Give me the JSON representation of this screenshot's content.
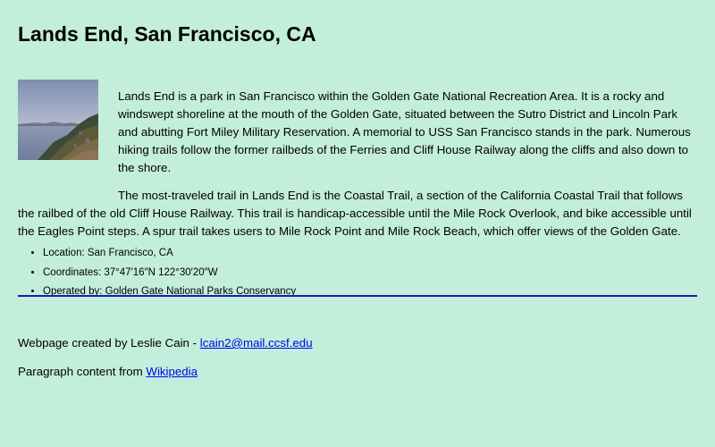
{
  "page_title": "Lands End, San Francisco, CA",
  "image": {
    "alt": "Lands End coastline at dusk"
  },
  "paragraphs": {
    "first": "Lands End is a park in San Francisco within the Golden Gate National Recreation Area. It is a rocky and windswept shoreline at the mouth of the Golden Gate, situated between the Sutro District and Lincoln Park and abutting Fort Miley Military Reservation. A memorial to USS San Francisco stands in the park. Numerous hiking trails follow the former railbeds of the Ferries and Cliff House Railway along the cliffs and also down to the shore.",
    "second": "The most-traveled trail in Lands End is the Coastal Trail, a section of the California Coastal Trail that follows the railbed of the old Cliff House Railway. This trail is handicap-accessible until the Mile Rock Overlook, and bike accessible until the Eagles Point steps. A spur trail takes users to Mile Rock Point and Mile Rock Beach, which offer views of the Golden Gate."
  },
  "facts": [
    {
      "label": "Location: San Francisco, CA"
    },
    {
      "label": "Coordinates: 37°47′16″N 122°30′20″W"
    },
    {
      "label": "Operated by: Golden Gate National Parks Conservancy"
    }
  ],
  "footer": {
    "credit_prefix": "Webpage created by Leslie Cain - ",
    "email_link": "lcain2@mail.ccsf.edu",
    "source_prefix": "Paragraph content from ",
    "source_link": "Wikipedia"
  },
  "colors": {
    "background": "#c3eedb",
    "rule": "#1a1ab0",
    "link": "#0000ee"
  }
}
